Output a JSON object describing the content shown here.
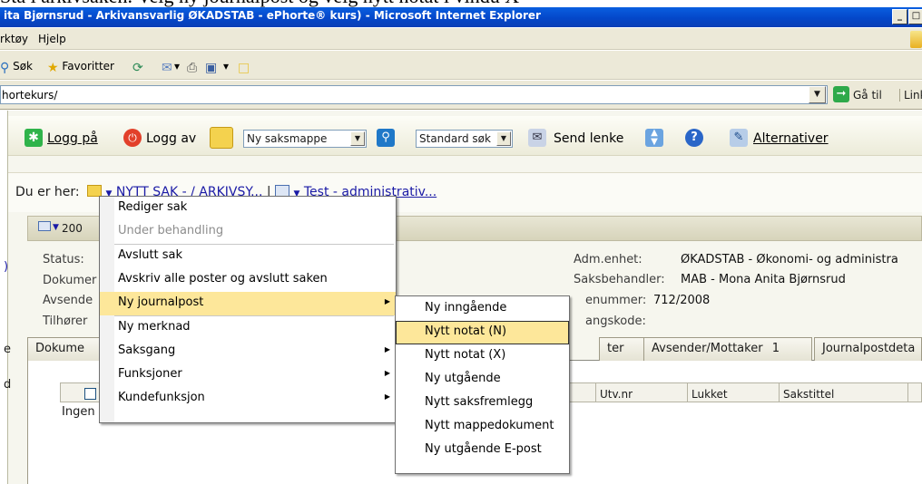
{
  "caption": "Stå i arkivsaken. Velg ny journalpost og velg nytt notat i vindu X",
  "window": {
    "title": "ita Bjørnsrud - Arkivansvarlig ØKADSTAB - ePhorte® kurs) - Microsoft Internet Explorer",
    "controls": [
      "_",
      "□"
    ]
  },
  "menubar": [
    "rktøy",
    "Hjelp"
  ],
  "ie_toolbar": {
    "search": "Søk",
    "favorites": "Favoritter"
  },
  "address_bar": {
    "value": "hortekurs/",
    "go": "Gå til",
    "links": "Links"
  },
  "app_toolbar": {
    "login": "Logg på",
    "logout": "Logg av",
    "new_folder_select": "Ny saksmappe",
    "search_select": "Standard søk",
    "send_link": "Send lenke",
    "options": "Alternativer"
  },
  "breadcrumb": {
    "prefix": "Du er her:",
    "item1": "NYTT SAK - / ARKIVSY...",
    "separator": "|",
    "item2": "Test - administrativ..."
  },
  "case_header": {
    "number": "200"
  },
  "info": {
    "left_labels": [
      "Status:",
      "Dokumer",
      "Avsende",
      "Tilhører"
    ],
    "right_labels": [
      "Adm.enhet:",
      "Saksbehandler:",
      "enummer:",
      "angskode:"
    ],
    "adm_enhet": "ØKADSTAB - Økonomi- og administra",
    "saksbehandler": "MAB - Mona Anita Bjørnsrud",
    "nummer": "712/2008"
  },
  "tabs": {
    "docs": "Dokume",
    "ter": "ter",
    "sender": "Avsender/Mottaker",
    "sender_count": "1",
    "details": "Journalpostdeta"
  },
  "table": {
    "headers": [
      "Utv.nr",
      "Lukket",
      "Sakstittel"
    ],
    "empty": "Ingen"
  },
  "context_menu": {
    "items": [
      {
        "label": "Rediger sak",
        "disabled": false,
        "submenu": false
      },
      {
        "label": "Under behandling",
        "disabled": true,
        "submenu": false
      },
      {
        "label": "Avslutt sak",
        "disabled": false,
        "submenu": false
      },
      {
        "label": "Avskriv alle poster og avslutt saken",
        "disabled": false,
        "submenu": false
      },
      {
        "label": "Ny journalpost",
        "disabled": false,
        "submenu": true,
        "highlighted": true
      },
      {
        "label": "Ny merknad",
        "disabled": false,
        "submenu": false
      },
      {
        "label": "Saksgang",
        "disabled": false,
        "submenu": true
      },
      {
        "label": "Funksjoner",
        "disabled": false,
        "submenu": true
      },
      {
        "label": "Kundefunksjon",
        "disabled": false,
        "submenu": true
      }
    ]
  },
  "submenu": {
    "items": [
      {
        "label": "Ny inngående",
        "highlighted": false
      },
      {
        "label": "Nytt notat (N)",
        "highlighted": true
      },
      {
        "label": "Nytt notat (X)",
        "highlighted": false
      },
      {
        "label": "Ny utgående",
        "highlighted": false
      },
      {
        "label": "Nytt saksfremlegg",
        "highlighted": false
      },
      {
        "label": "Nytt mappedokument",
        "highlighted": false
      },
      {
        "label": "Ny utgående E-post",
        "highlighted": false
      }
    ]
  },
  "colors": {
    "titlebar": "#0447c9",
    "menu_highlight": "#fde79a",
    "link": "#1a1aa6"
  }
}
